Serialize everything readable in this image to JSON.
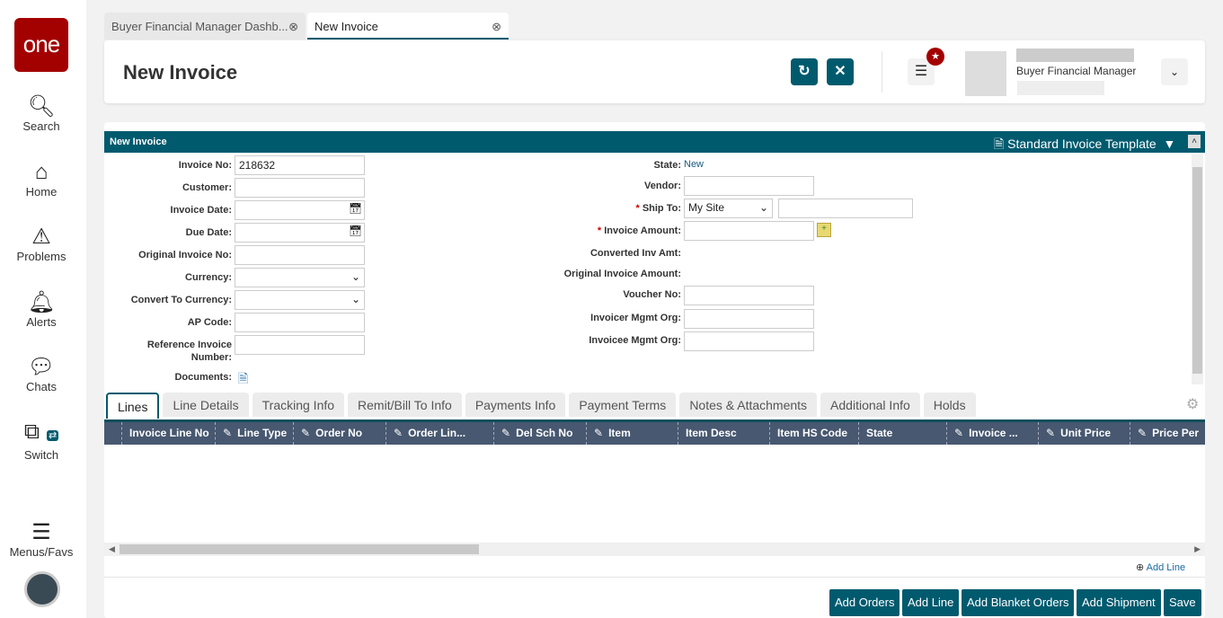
{
  "sidebar": {
    "logo": "one",
    "items": [
      {
        "label": "Search",
        "icon": "search-icon"
      },
      {
        "label": "Home",
        "icon": "home-icon"
      },
      {
        "label": "Problems",
        "icon": "warning-icon"
      },
      {
        "label": "Alerts",
        "icon": "bell-icon"
      },
      {
        "label": "Chats",
        "icon": "chat-icon"
      },
      {
        "label": "Switch",
        "icon": "switch-icon"
      },
      {
        "label": "Menus/Favs",
        "icon": "menu-icon"
      }
    ]
  },
  "tabs": [
    {
      "label": "Buyer Financial Manager Dashb..."
    },
    {
      "label": "New Invoice"
    }
  ],
  "header": {
    "title": "New Invoice",
    "role": "Buyer Financial Manager"
  },
  "section": {
    "title": "New Invoice",
    "template": "Standard Invoice Template"
  },
  "form_left": [
    {
      "label": "Invoice No:",
      "value": "218632"
    },
    {
      "label": "Customer:",
      "value": ""
    },
    {
      "label": "Invoice Date:",
      "value": ""
    },
    {
      "label": "Due Date:",
      "value": ""
    },
    {
      "label": "Original Invoice No:",
      "value": ""
    },
    {
      "label": "Currency:",
      "value": ""
    },
    {
      "label": "Convert To Currency:",
      "value": ""
    },
    {
      "label": "AP Code:",
      "value": ""
    },
    {
      "label": "Reference Invoice Number:",
      "value": ""
    },
    {
      "label": "Documents:",
      "value": ""
    }
  ],
  "form_right": {
    "state_label": "State:",
    "state_value": "New",
    "vendor": "Vendor:",
    "ship_to": "Ship To:",
    "ship_to_value": "My Site",
    "invoice_amount": "Invoice Amount:",
    "converted": "Converted Inv Amt:",
    "original_amount": "Original Invoice Amount:",
    "voucher": "Voucher No:",
    "invoicer": "Invoicer Mgmt Org:",
    "invoicee": "Invoicee Mgmt Org:",
    "required_mark": "*"
  },
  "inner_tabs": [
    "Lines",
    "Line Details",
    "Tracking Info",
    "Remit/Bill To Info",
    "Payments Info",
    "Payment Terms",
    "Notes & Attachments",
    "Additional Info",
    "Holds"
  ],
  "columns": [
    {
      "label": "Invoice Line No",
      "editable": false
    },
    {
      "label": "Line Type",
      "editable": true
    },
    {
      "label": "Order No",
      "editable": true
    },
    {
      "label": "Order Lin...",
      "editable": true
    },
    {
      "label": "Del Sch No",
      "editable": true
    },
    {
      "label": "Item",
      "editable": true
    },
    {
      "label": "Item Desc",
      "editable": false
    },
    {
      "label": "Item HS Code",
      "editable": false
    },
    {
      "label": "State",
      "editable": false
    },
    {
      "label": "Invoice ...",
      "editable": true
    },
    {
      "label": "Unit Price",
      "editable": true
    },
    {
      "label": "Price Per",
      "editable": true
    }
  ],
  "add_line_link": "Add Line",
  "buttons": [
    "Add Orders",
    "Add Line",
    "Add Blanket Orders",
    "Add Shipment",
    "Save"
  ]
}
